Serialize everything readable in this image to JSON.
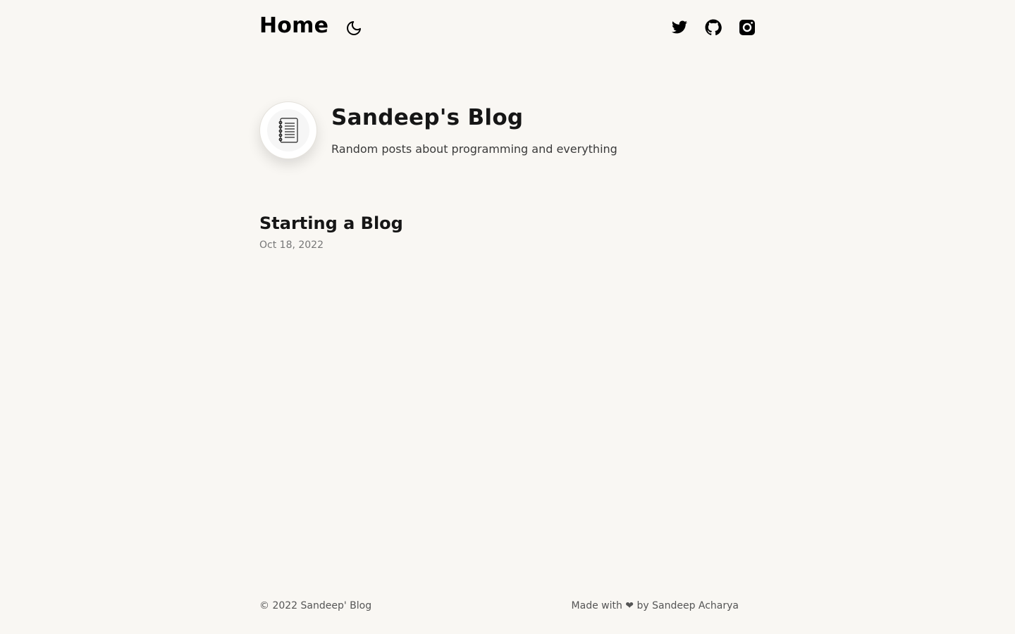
{
  "header": {
    "home_label": "Home",
    "theme_toggle_icon": "moon-icon",
    "social": [
      {
        "name": "twitter",
        "icon": "twitter-icon"
      },
      {
        "name": "github",
        "icon": "github-icon"
      },
      {
        "name": "instagram",
        "icon": "instagram-icon"
      }
    ]
  },
  "bio": {
    "avatar_icon": "notebook-icon",
    "title": "Sandeep's Blog",
    "description": "Random posts about programming and everything"
  },
  "posts": [
    {
      "title": "Starting a Blog",
      "date": "Oct 18, 2022"
    }
  ],
  "footer": {
    "copyright": "© 2022 Sandeep' Blog",
    "made_with": "Made with ❤ by Sandeep Acharya"
  },
  "colors": {
    "background": "#f9f7f3",
    "text": "#161616",
    "muted": "#777777"
  }
}
